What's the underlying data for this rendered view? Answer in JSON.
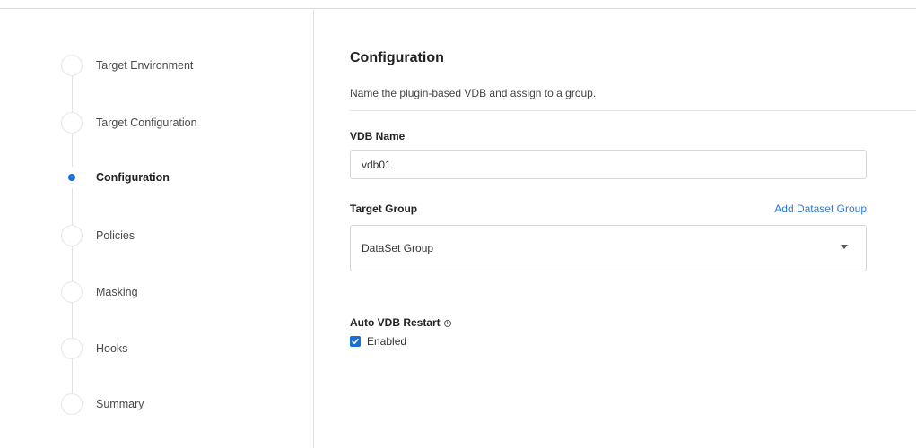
{
  "wizard": {
    "steps": [
      {
        "label": "Target Environment",
        "active": false
      },
      {
        "label": "Target Configuration",
        "active": false
      },
      {
        "label": "Configuration",
        "active": true
      },
      {
        "label": "Policies",
        "active": false
      },
      {
        "label": "Masking",
        "active": false
      },
      {
        "label": "Hooks",
        "active": false
      },
      {
        "label": "Summary",
        "active": false
      }
    ],
    "accent_color": "#1a6fd6"
  },
  "main": {
    "title": "Configuration",
    "subtitle": "Name the plugin-based VDB and assign to a group.",
    "vdb_name": {
      "label": "VDB Name",
      "value": "vdb01"
    },
    "target_group": {
      "label": "Target Group",
      "add_link": "Add Dataset Group",
      "selected": "DataSet Group",
      "icon": "chevron-down-icon"
    },
    "auto_restart": {
      "label": "Auto VDB Restart",
      "info_icon": "info-icon",
      "checkbox_label": "Enabled",
      "checked": true
    }
  }
}
